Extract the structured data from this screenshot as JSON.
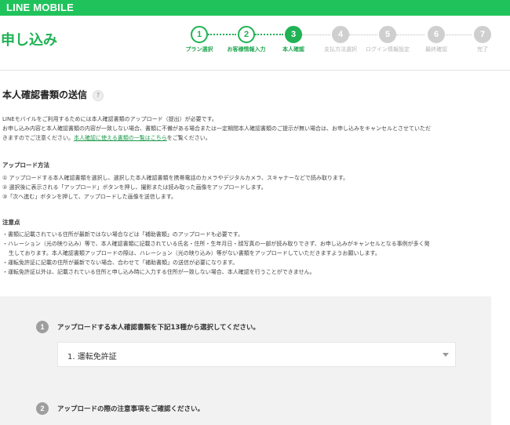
{
  "header": {
    "logo": "LINE MOBILE"
  },
  "page_title": "申し込み",
  "steps": [
    {
      "num": "1",
      "label": "プラン選択",
      "state": "done"
    },
    {
      "num": "2",
      "label": "お客様情報入力",
      "state": "done"
    },
    {
      "num": "3",
      "label": "本人確認",
      "state": "current"
    },
    {
      "num": "4",
      "label": "支払方法選択",
      "state": "todo"
    },
    {
      "num": "5",
      "label": "ログイン情報設定",
      "state": "todo"
    },
    {
      "num": "6",
      "label": "最終確認",
      "state": "todo"
    },
    {
      "num": "7",
      "label": "完了",
      "state": "todo"
    }
  ],
  "section": {
    "title": "本人確認書類の送信",
    "help": "?",
    "intro_1": "LINEモバイルをご利用するためには本人確認書類のアップロード（提出）が必要です。",
    "intro_2": "お申し込み内容と本人確認書類の内容が一致しない場合、書類に不備がある場合または一定期間本人確認書類のご提示が無い場合は、お申し込みをキャンセルとさせていただ",
    "intro_3a": "きますのでご注意ください。",
    "intro_link": "本人確認に使える書類の一覧はこちら",
    "intro_3b": "をご覧ください。"
  },
  "upload": {
    "heading": "アップロード方法",
    "steps": [
      "① アップロードする本人確認書類を選択し、選択した本人確認書類を携帯電話のカメラやデジタルカメラ、スキャナーなどで読み取ります。",
      "② 選択後に表示される「アップロード」ボタンを押し、撮影または読み取った画像をアップロードします。",
      "③「次へ進む」ボタンを押して、アップロードした画像を送信します。"
    ]
  },
  "notes": {
    "heading": "注意点",
    "items": [
      "・書類に記載されている住所が最新ではない場合などは「補助書類」のアップロードも必要です。",
      "・ハレーション（光の映り込み）等で、本人確認書類に記載されている氏名・住所・生年月日・顔写真の一部が読み取りできず、お申し込みがキャンセルとなる事例が多く発",
      "生しております。本人確認書類アップロードの際は、ハレーション（光の映り込み）等がない書類をアップロードしていただきますようお願いします。",
      "・運転免許証に記載の住所が最新でない場合、合わせて「補助書類」の送信が必要になります。",
      "・運転免許証以外は、記載されている住所と申し込み時に入力する住所が一致しない場合、本人確認を行うことができません。"
    ]
  },
  "form": {
    "q1_num": "1",
    "q1_text": "アップロードする本人確認書類を下記13種から選択してください。",
    "q1_select": "1. 運転免許証",
    "q2_num": "2",
    "q2_text": "アップロードの際の注意事項をご確認ください。"
  },
  "colors": {
    "brand": "#20c35b",
    "step_done": "#20b255",
    "step_todo": "#cfcfcf"
  }
}
